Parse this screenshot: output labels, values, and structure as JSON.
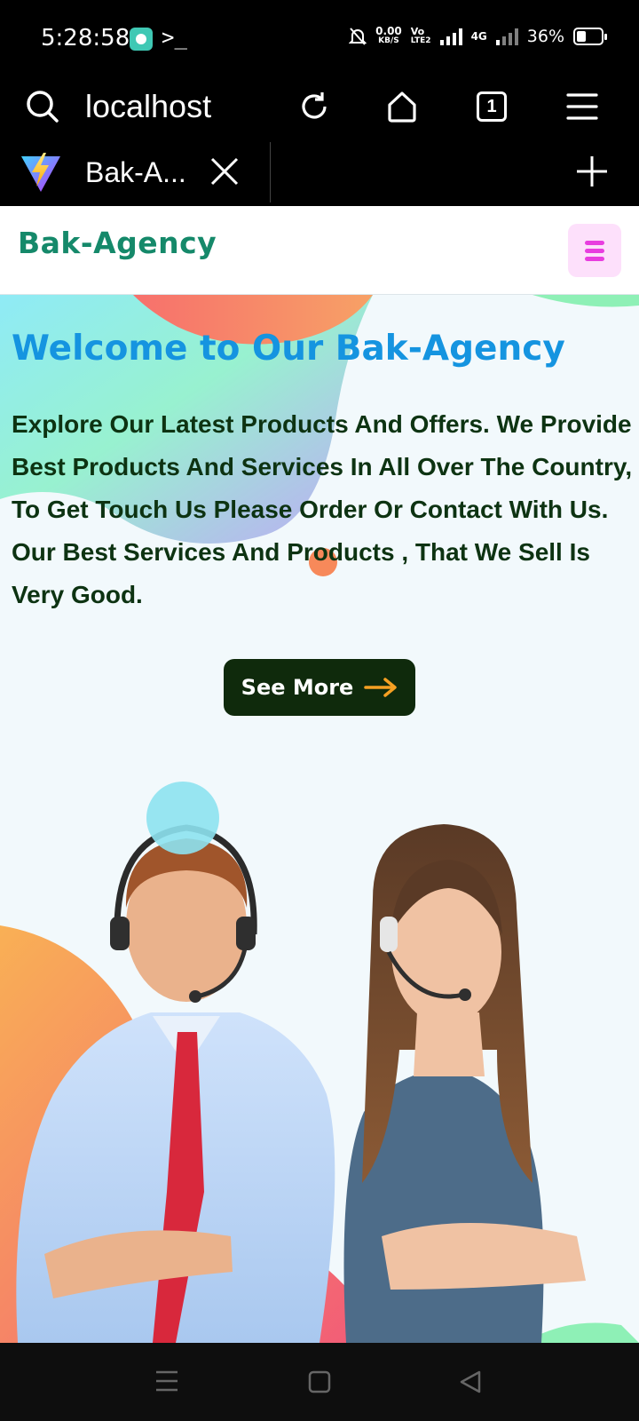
{
  "status_bar": {
    "time": "5:28:58",
    "terminal": ">_",
    "net_speed": "0.00",
    "net_unit": "KB/S",
    "volte": "Vo",
    "volte_sub": "LTE2",
    "net_type": "4G",
    "battery": "36%"
  },
  "browser": {
    "url": "localhost",
    "tab_count": "1",
    "tab_title": "Bak-A..."
  },
  "site": {
    "brand": "Bak-Agency",
    "hero_title": "Welcome to Our Bak-Agency",
    "hero_text": "Explore Our Latest Products And Offers. We Provide Best Products And Services In All Over The Country, To Get Touch Us Please Order Or Contact With Us. Our Best Services And Products , That We Sell Is Very Good.",
    "cta_label": "See More"
  },
  "colors": {
    "brand": "#15896a",
    "hero_title": "#1594e0",
    "hero_text": "#0d3312",
    "cta_bg": "#0f2a0c",
    "cta_arrow": "#f5a023",
    "menu_bg": "#fde0fb",
    "menu_icon": "#e83ddf"
  }
}
